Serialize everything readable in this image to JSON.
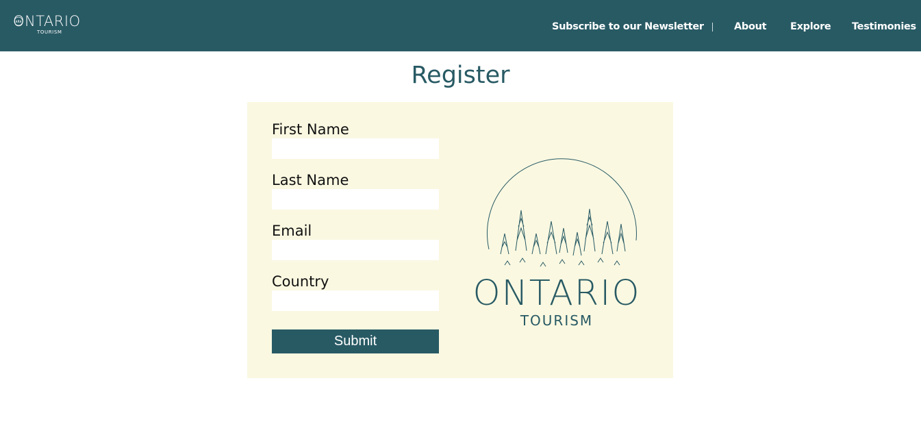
{
  "header": {
    "logo_text": "ONTARIO",
    "logo_sub": "TOURISM",
    "nav": [
      {
        "label": "Subscribe to our Newsletter"
      },
      {
        "label": "About"
      },
      {
        "label": "Explore"
      },
      {
        "label": "Testimonies"
      }
    ]
  },
  "main": {
    "title": "Register",
    "form": {
      "fields": [
        {
          "label": "First Name",
          "value": "",
          "placeholder": ""
        },
        {
          "label": "Last Name",
          "value": "",
          "placeholder": ""
        },
        {
          "label": "Email",
          "value": "",
          "placeholder": ""
        },
        {
          "label": "Country",
          "value": "",
          "placeholder": ""
        }
      ],
      "submit_label": "Submit"
    },
    "brand": {
      "name": "ONTARIO",
      "sub": "TOURISM",
      "icon": "forest-circle-icon"
    }
  },
  "colors": {
    "primary": "#285a64",
    "card_bg": "#faf8e1",
    "page_bg": "#ffffff"
  }
}
